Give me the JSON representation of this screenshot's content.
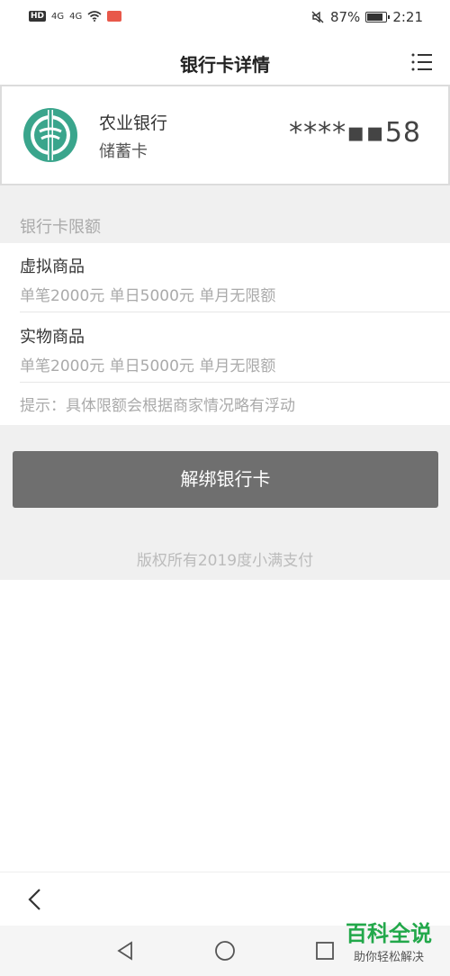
{
  "status_bar": {
    "hd": "HD",
    "signal1": "4G",
    "signal2": "4G",
    "battery_percent": "87%",
    "battery_level": 0.87,
    "time": "2:21"
  },
  "nav": {
    "title": "银行卡详情"
  },
  "card": {
    "bank_name": "农业银行",
    "card_type": "储蓄卡",
    "card_number": "****▪▪58",
    "logo_color": "#3aa58c"
  },
  "limits": {
    "section_title": "银行卡限额",
    "items": [
      {
        "name": "虚拟商品",
        "desc": "单笔2000元 单日5000元 单月无限额"
      },
      {
        "name": "实物商品",
        "desc": "单笔2000元 单日5000元 单月无限额"
      }
    ],
    "hint": "提示：具体限额会根据商家情况略有浮动"
  },
  "actions": {
    "unbind_label": "解绑银行卡"
  },
  "footer": {
    "copyright": "版权所有2019度小满支付"
  },
  "watermark": {
    "main": "百科全说",
    "sub": "助你轻松解决"
  }
}
